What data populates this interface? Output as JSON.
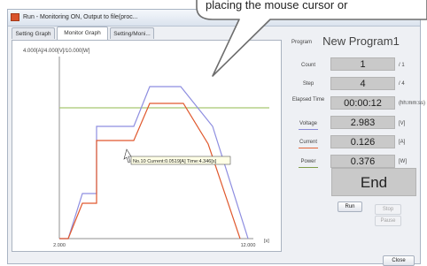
{
  "window": {
    "title": "Run - Monitoring ON, Output to file(proc..."
  },
  "callout": {
    "text": "placing the mouse cursor or"
  },
  "tabs": [
    {
      "label": "Setting Graph",
      "active": false
    },
    {
      "label": "Monitor Graph",
      "active": true
    },
    {
      "label": "Setting/Moni...",
      "active": false
    }
  ],
  "graph": {
    "scale_label": "4.000[A]/4.000[V]/10.000[W]",
    "x_start": "2.000",
    "x_end": "12.000",
    "x_unit": "[s]",
    "tooltip": "No.10 Current:0.0519[A] Time:4.346[s]",
    "series_colors": {
      "voltage": "#8e8ee0",
      "current": "#e0582d",
      "power": "#a8c870",
      "axis": "#909090"
    }
  },
  "panel": {
    "program_label": "Program",
    "program_name": "New Program1",
    "count": {
      "label": "Count",
      "value": "1",
      "unit": "/ 1"
    },
    "step": {
      "label": "Step",
      "value": "4",
      "unit": "/ 4"
    },
    "elapsed": {
      "label": "Elapsed Time",
      "value": "00:00:12",
      "unit": "(hh:mm:ss)"
    },
    "voltage": {
      "label": "Voltage",
      "value": "2.983",
      "unit": "[V]",
      "color": "#8a8ad8"
    },
    "current": {
      "label": "Current",
      "value": "0.126",
      "unit": "[A]",
      "color": "#e26537"
    },
    "power": {
      "label": "Power",
      "value": "0.376",
      "unit": "[W]",
      "color": "#7f9d4a"
    },
    "status": "End",
    "buttons": {
      "run": "Run",
      "stop": "Stop",
      "pause": "Pause",
      "close": "Close"
    }
  }
}
